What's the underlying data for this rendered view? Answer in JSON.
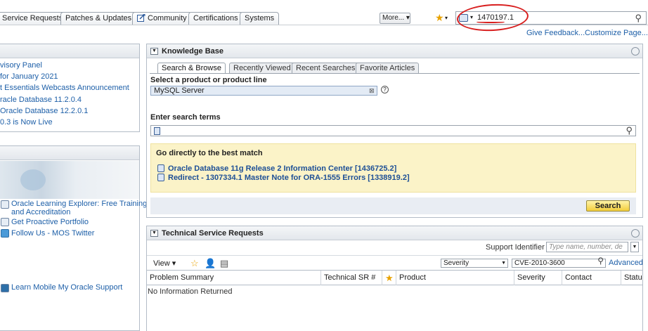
{
  "top_tabs": [
    "Service Requests",
    "Patches & Updates",
    "Community",
    "Certifications",
    "Systems"
  ],
  "more_button": "More...",
  "global_search": {
    "value": "1470197.1"
  },
  "header_links": {
    "feedback": "Give Feedback...",
    "customize": "Customize Page..."
  },
  "left_panel_1": {
    "items": [
      "visory Panel",
      "for January 2021",
      "t Essentials Webcasts Announcement",
      "racle Database 11.2.0.4",
      "Oracle Database 12.2.0.1",
      "0.3 is Now Live"
    ]
  },
  "left_panel_2": {
    "items": [
      "Oracle Learning Explorer: Free Training",
      "and Accreditation",
      "Get Proactive Portfolio",
      "Follow Us - MOS Twitter",
      "Learn Mobile My Oracle Support"
    ]
  },
  "knowledge_base": {
    "title": "Knowledge Base",
    "tabs": [
      "Search & Browse",
      "Recently Viewed",
      "Recent Searches",
      "Favorite Articles"
    ],
    "product_label": "Select a product or product line",
    "product_value": "MySQL Server",
    "terms_label": "Enter search terms",
    "best_match_title": "Go directly to the best match",
    "best_match_links": [
      "Oracle Database 11g Release 2 Information Center [1436725.2]",
      "Redirect - 1307334.1 Master Note for ORA-1555 Errors [1338919.2]"
    ],
    "search_button": "Search"
  },
  "tech_sr": {
    "title": "Technical Service Requests",
    "support_identifier_label": "Support Identifier",
    "support_identifier_placeholder": "Type name, number, de",
    "view_label": "View",
    "severity_select": "Severity",
    "filter_value": "CVE-2010-3600",
    "advanced_link": "Advanced",
    "columns": [
      "Problem Summary",
      "Technical SR #",
      "Product",
      "Severity",
      "Contact",
      "Status"
    ],
    "empty_message": "No Information Returned"
  }
}
